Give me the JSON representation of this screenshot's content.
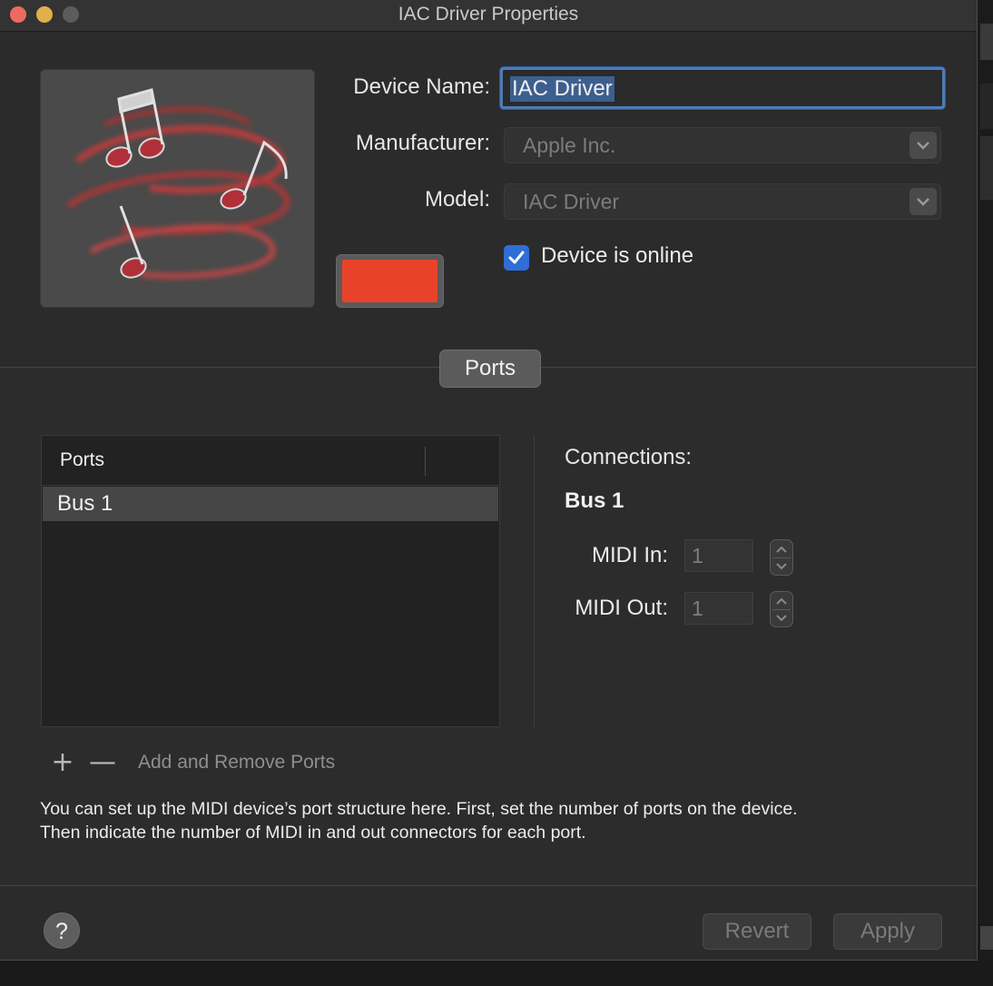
{
  "window": {
    "title": "IAC Driver Properties"
  },
  "device": {
    "name_label": "Device Name:",
    "name_value": "IAC Driver",
    "manufacturer_label": "Manufacturer:",
    "manufacturer_value": "Apple Inc.",
    "model_label": "Model:",
    "model_value": "IAC Driver",
    "online_label": "Device is online",
    "online_checked": true,
    "color": "#e8432a"
  },
  "tabs": {
    "ports_tab": "Ports"
  },
  "ports_table": {
    "header": "Ports",
    "rows": [
      "Bus 1"
    ]
  },
  "connections": {
    "title": "Connections:",
    "selected_port": "Bus 1",
    "midi_in_label": "MIDI In:",
    "midi_in_value": "1",
    "midi_out_label": "MIDI Out:",
    "midi_out_value": "1"
  },
  "port_controls": {
    "add_symbol": "+",
    "remove_symbol": "—",
    "label": "Add and Remove Ports"
  },
  "help_text_line1": "You can set up the MIDI device’s port structure here. First, set the number of ports on the device.",
  "help_text_line2": "Then indicate the number of MIDI in and out connectors for each port.",
  "footer": {
    "help_symbol": "?",
    "revert_label": "Revert",
    "apply_label": "Apply"
  },
  "colors": {
    "accent": "#2f6dd8",
    "focus_ring": "#4f7bb5",
    "window_bg": "#2b2b2b"
  }
}
